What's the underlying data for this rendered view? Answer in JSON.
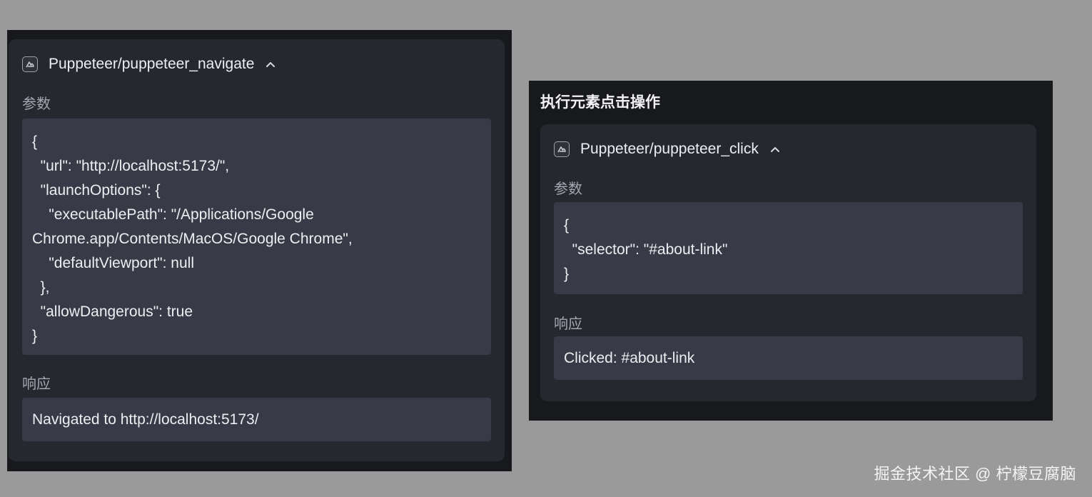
{
  "left": {
    "tool_name": "Puppeteer/puppeteer_navigate",
    "params_label": "参数",
    "params_code": "{\n  \"url\": \"http://localhost:5173/\",\n  \"launchOptions\": {\n    \"executablePath\": \"/Applications/Google Chrome.app/Contents/MacOS/Google Chrome\",\n    \"defaultViewport\": null\n  },\n  \"allowDangerous\": true\n}",
    "response_label": "响应",
    "response_text": "Navigated to http://localhost:5173/"
  },
  "right": {
    "title": "执行元素点击操作",
    "tool_name": "Puppeteer/puppeteer_click",
    "params_label": "参数",
    "params_code": "{\n  \"selector\": \"#about-link\"\n}",
    "response_label": "响应",
    "response_text": "Clicked: #about-link"
  },
  "watermark": "掘金技术社区 @ 柠檬豆腐脑",
  "icons": {
    "tool": "puppeteer-tool-icon",
    "collapse": "chevron-up-icon"
  },
  "colors": {
    "page_bg": "#9a9a9a",
    "panel_bg": "#17191d",
    "card_bg": "#262830",
    "code_bg": "#383b47",
    "muted_text": "#a4a7af"
  }
}
